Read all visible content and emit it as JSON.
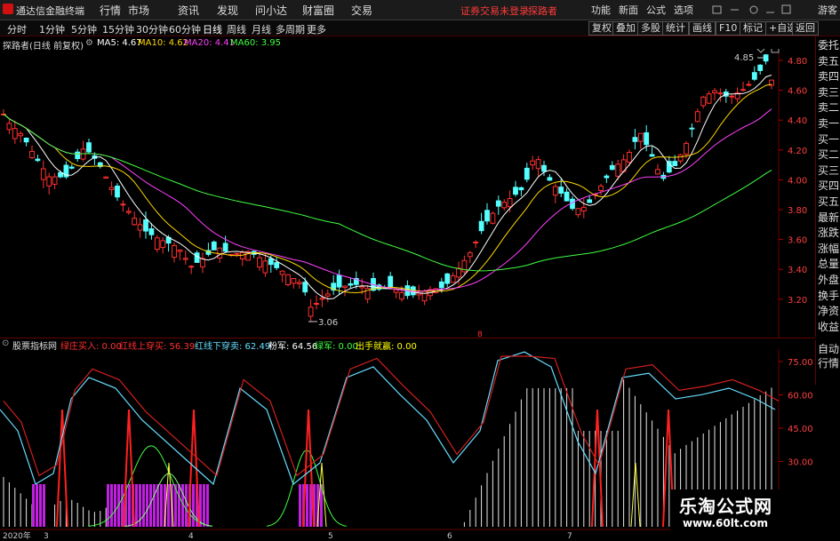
{
  "app": {
    "title": "通达信金融终端"
  },
  "menu": [
    "行情",
    "市场",
    "资讯",
    "发现",
    "问小达",
    "财富圈",
    "交易"
  ],
  "notice": "证券交易未登录",
  "user_link": "探路者",
  "top_right": [
    "功能",
    "新面",
    "公式",
    "选项"
  ],
  "guest": "游客",
  "periods": [
    "分时",
    "1分钟",
    "5分钟",
    "15分钟",
    "30分钟",
    "60分钟",
    "日线",
    "周线",
    "月线",
    "多周期",
    "更多"
  ],
  "active_period": "日线",
  "toolbar_right": [
    "复权",
    "叠加",
    "多股",
    "统计",
    "画线",
    "F10",
    "标记",
    "+自选",
    "返回"
  ],
  "stock_label": "探路者(日线 前复权)",
  "ma": [
    {
      "label": "MA5: 4.67",
      "color": "#ffffff"
    },
    {
      "label": "MA10: 4.62",
      "color": "#ffd700"
    },
    {
      "label": "MA20: 4.41",
      "color": "#ff40ff"
    },
    {
      "label": "MA60: 3.95",
      "color": "#40ff40"
    }
  ],
  "price_axis": [
    "4.80",
    "4.60",
    "4.40",
    "4.20",
    "4.00",
    "3.80",
    "3.60",
    "3.40",
    "3.20"
  ],
  "high_label": "4.85",
  "low_label": "3.06",
  "side_buttons": [
    "委托",
    "卖五",
    "卖四",
    "卖三",
    "卖二",
    "卖一",
    "买一",
    "买二",
    "买三",
    "买四",
    "买五",
    "最新",
    "涨跌",
    "涨幅",
    "总量",
    "外盘",
    "换手",
    "净资",
    "收益"
  ],
  "side_buttons2": [
    "自动",
    "行情"
  ],
  "indicator": {
    "name": "股票指标网",
    "items": [
      {
        "label": "绿庄买入: 0.00",
        "color": "#ff3030"
      },
      {
        "label": "红线上穿买: 56.39",
        "color": "#ff3030"
      },
      {
        "label": "红线下穿卖: 62.49",
        "color": "#66ddff"
      },
      {
        "label": "粉军: 64.56",
        "color": "#ffffff"
      },
      {
        "label": "绿军: 0.00",
        "color": "#40ff40"
      },
      {
        "label": "出手就赢: 0.00",
        "color": "#ffff00"
      }
    ],
    "axis": [
      "75.00",
      "60.00",
      "45.00",
      "30.00"
    ]
  },
  "date_axis": [
    "2020年",
    "3",
    "4",
    "5",
    "6",
    "7"
  ],
  "watermark": {
    "name": "乐淘公式网",
    "url": "www.60lt.com"
  }
}
